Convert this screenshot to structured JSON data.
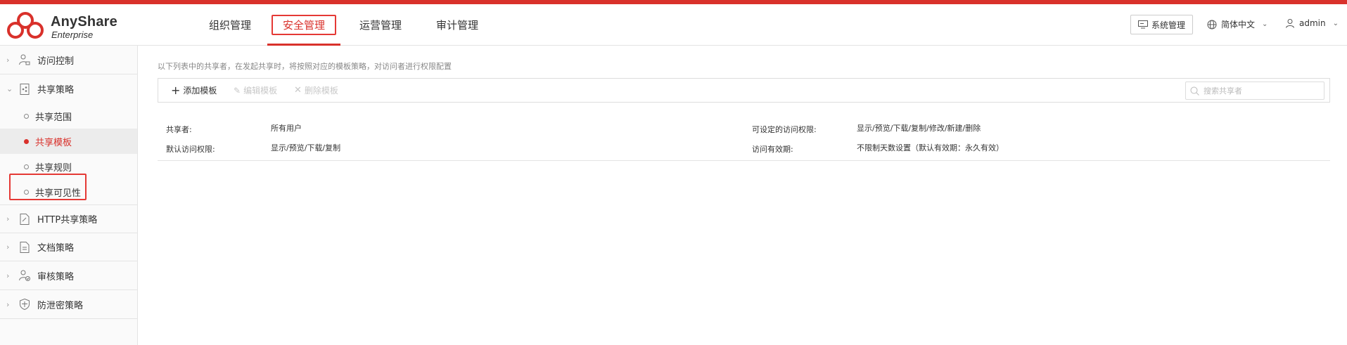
{
  "brand": {
    "name": "AnyShare",
    "subtitle": "Enterprise"
  },
  "nav": {
    "items": [
      {
        "label": "组织管理"
      },
      {
        "label": "安全管理"
      },
      {
        "label": "运营管理"
      },
      {
        "label": "审计管理"
      }
    ],
    "active_index": 1
  },
  "header": {
    "system_button": "系统管理",
    "language": "简体中文",
    "user": "admin"
  },
  "sidebar": {
    "groups": [
      {
        "label": "访问控制",
        "icon": "user-lock-icon"
      },
      {
        "label": "共享策略",
        "icon": "share-doc-icon"
      },
      {
        "label": "HTTP共享策略",
        "icon": "http-doc-icon"
      },
      {
        "label": "文档策略",
        "icon": "document-icon"
      },
      {
        "label": "审核策略",
        "icon": "user-check-icon"
      },
      {
        "label": "防泄密策略",
        "icon": "shield-icon"
      }
    ],
    "share_sub_items": [
      {
        "label": "共享范围"
      },
      {
        "label": "共享模板"
      },
      {
        "label": "共享规则"
      },
      {
        "label": "共享可见性"
      }
    ],
    "active_sub_index": 1
  },
  "main": {
    "description": "以下列表中的共享者，在发起共享时，将按照对应的模板策略，对访问者进行权限配置",
    "toolbar": {
      "add": "添加模板",
      "edit": "编辑模板",
      "delete": "删除模板"
    },
    "search": {
      "placeholder": "搜索共享者"
    },
    "template": {
      "sharer_label": "共享者:",
      "sharer_value": "所有用户",
      "default_perm_label": "默认访问权限:",
      "default_perm_value": "显示/预览/下载/复制",
      "settable_perm_label": "可设定的访问权限:",
      "settable_perm_value": "显示/预览/下载/复制/修改/新建/删除",
      "validity_label": "访问有效期:",
      "validity_value": "不限制天数设置（默认有效期：永久有效）"
    }
  },
  "colors": {
    "accent": "#d9312b",
    "highlight_box": "#e53935"
  }
}
